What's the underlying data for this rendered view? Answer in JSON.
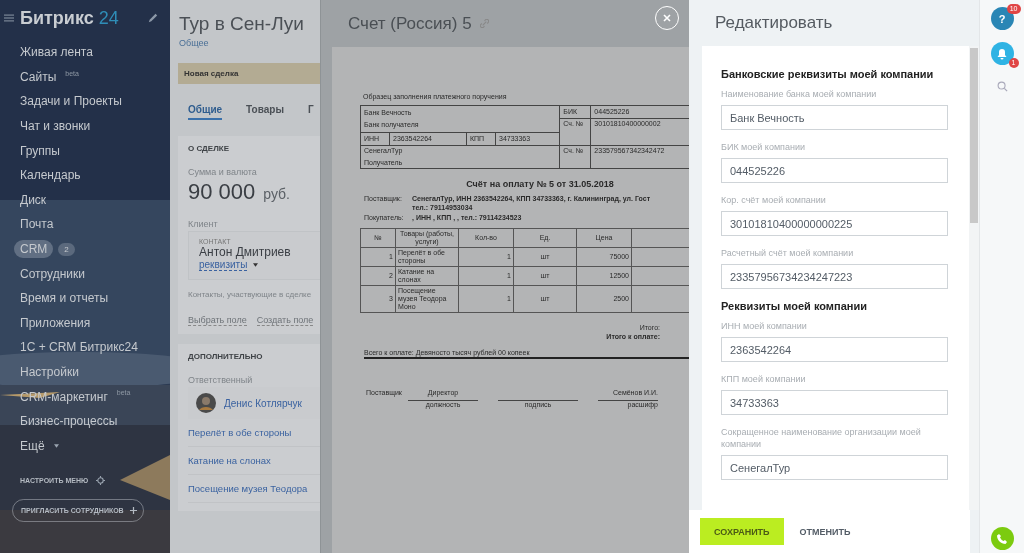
{
  "sidebar": {
    "logo_text": "Битрикс",
    "logo_number": "24",
    "items": [
      {
        "label": "Живая лента",
        "selected": false
      },
      {
        "label": "Сайты",
        "sup": "beta",
        "selected": false
      },
      {
        "label": "Задачи и Проекты",
        "selected": false
      },
      {
        "label": "Чат и звонки",
        "selected": false
      },
      {
        "label": "Группы",
        "selected": false
      },
      {
        "label": "Календарь",
        "selected": false
      },
      {
        "label": "Диск",
        "selected": false
      },
      {
        "label": "Почта",
        "selected": false
      },
      {
        "label": "CRM",
        "badge": "2",
        "selected": true
      },
      {
        "label": "Сотрудники",
        "selected": false
      },
      {
        "label": "Время и отчеты",
        "selected": false
      },
      {
        "label": "Приложения",
        "selected": false
      },
      {
        "label": "1С + CRM Битрикс24",
        "selected": false
      },
      {
        "label": "Настройки",
        "selected": false
      },
      {
        "label": "CRM-маркетинг",
        "sup": "beta",
        "selected": false
      },
      {
        "label": "Бизнес-процессы",
        "selected": false
      },
      {
        "label": "Ещё",
        "caret": true,
        "selected": false
      }
    ],
    "configure": "НАСТРОИТЬ МЕНЮ",
    "invite": "ПРИГЛАСИТЬ СОТРУДНИКОВ"
  },
  "deal": {
    "title": "Тур в Сен-Луи",
    "subtitle": "Общее",
    "stage": "Новая сделка",
    "tabs": [
      {
        "label": "Общие",
        "selected": true
      },
      {
        "label": "Товары",
        "selected": false
      },
      {
        "label": "Г",
        "selected": false
      }
    ],
    "about": {
      "heading": "О СДЕЛКЕ",
      "sum_label": "Сумма и валюта",
      "sum": "90 000",
      "currency": "руб.",
      "client_label": "Клиент",
      "contact_kind": "КОНТАКТ",
      "contact_name": "Антон Дмитриев",
      "requisites": "реквизиты",
      "participants": "Контакты, участвующие в сделке",
      "actions": [
        "Выбрать поле",
        "Создать поле"
      ]
    },
    "extra": {
      "heading": "ДОПОЛНИТЕЛЬНО",
      "responsible_label": "Ответственный",
      "responsible": "Денис Котлярчук",
      "products": [
        "Перелёт в обе стороны",
        "Катание на слонах",
        "Посещение музея Теодора"
      ]
    }
  },
  "document": {
    "title": "Счет (Россия) 5",
    "sample_caption": "Образец заполнения платежного поручения",
    "bank": {
      "bank_name": "Банк Вечность",
      "bank_caption": "Банк получателя",
      "inn_label": "ИНН",
      "inn": "2363542264",
      "kpp_label": "КПП",
      "kpp": "34733363",
      "recipient": "СенегалТур",
      "recipient_caption": "Получатель",
      "bik_label": "БИК",
      "bik": "044525226",
      "acc_label_1": "Сч. №",
      "acc_1": "30101810400000002",
      "acc_label_2": "Сч. №",
      "acc_2": "233579567342342472"
    },
    "invoice_title": "Счёт на оплату № 5 от 31.05.2018",
    "supplier_label": "Поставщик:",
    "supplier": "СенегалТур, ИНН 2363542264, КПП 34733363, г. Калининград, ул. Гост",
    "supplier_phone": "тел.: 79114953034",
    "buyer_label": "Покупатель:",
    "buyer": ", ИНН , КПП , , тел.: 79114234523",
    "items": {
      "columns": [
        "№",
        "Товары (работы, услуги)",
        "Кол-во",
        "Ед.",
        "Цена"
      ],
      "rows": [
        [
          "1",
          "Перелёт в обе стороны",
          "1",
          "шт",
          "75000"
        ],
        [
          "2",
          "Катание на слонах",
          "1",
          "шт",
          "12500"
        ],
        [
          "3",
          "Посещение музея Теодора Моно",
          "1",
          "шт",
          "2500"
        ]
      ]
    },
    "total_label": "Итого:",
    "total_due_label": "Итого к оплате:",
    "total_words": "Всего к оплате: Девяносто тысяч рублей 00 копеек",
    "signatures": {
      "supplier_label": "Поставщик",
      "position": "Директор",
      "position_caption": "должность",
      "signature_caption": "подпись",
      "name": "Семёнов И.И.",
      "name_caption": "расшифр"
    }
  },
  "editor": {
    "title": "Редактировать",
    "sections": [
      {
        "kind": "heading",
        "text": "Банковские реквизиты моей компании"
      },
      {
        "kind": "field",
        "label": "Наименование банка моей компании",
        "value": "Банк Вечность"
      },
      {
        "kind": "field",
        "label": "БИК моей компании",
        "value": "044525226"
      },
      {
        "kind": "field",
        "label": "Кор. счёт моей компании",
        "value": "30101810400000000225"
      },
      {
        "kind": "field",
        "label": "Расчетный счёт моей компании",
        "value": "23357956734234247223"
      },
      {
        "kind": "heading",
        "text": "Реквизиты моей компании"
      },
      {
        "kind": "field",
        "label": "ИНН моей компании",
        "value": "2363542264"
      },
      {
        "kind": "field",
        "label": "КПП моей компании",
        "value": "34733363"
      },
      {
        "kind": "field",
        "label": "Сокращенное наименование организации моей компании",
        "value": "СенегалТур"
      }
    ],
    "buttons": [
      {
        "label": "СОХРАНИТЬ",
        "kind": "primary"
      },
      {
        "label": "ОТМЕНИТЬ",
        "kind": "link"
      }
    ]
  },
  "rightbar": {
    "help_label": "?",
    "help_badge": "10",
    "notifications_badge": "1"
  }
}
